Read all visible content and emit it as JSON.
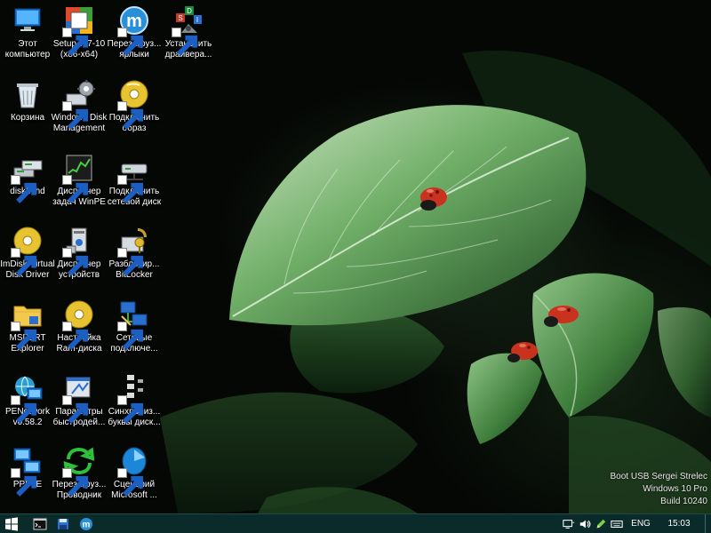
{
  "desktop": {
    "icons": [
      {
        "label": "Этот\nкомпьютер",
        "icon": "computer-icon",
        "shortcut": false
      },
      {
        "label": "Setup W7-10\n(x86-x64)",
        "icon": "setup-icon",
        "shortcut": true
      },
      {
        "label": "Перезагруз...\nярлыки",
        "icon": "m-circle-icon",
        "shortcut": true
      },
      {
        "label": "Установить\nдрайвера...",
        "icon": "sdi-icon",
        "shortcut": true
      },
      {
        "label": "Корзина",
        "icon": "recycle-bin-icon",
        "shortcut": false
      },
      {
        "label": "Windows Disk\nManagement",
        "icon": "disk-management-icon",
        "shortcut": true
      },
      {
        "label": "Подключить\nобраз",
        "icon": "disc-icon",
        "shortcut": true
      },
      {
        "label": "disk2vhd",
        "icon": "disk2vhd-icon",
        "shortcut": true
      },
      {
        "label": "Диспетчер\nзадач WinPE",
        "icon": "task-manager-icon",
        "shortcut": true
      },
      {
        "label": "Подключить\nсетевой диск",
        "icon": "network-drive-icon",
        "shortcut": true
      },
      {
        "label": "ImDisk Virtual\nDisk Driver",
        "icon": "imdisk-icon",
        "shortcut": true
      },
      {
        "label": "Диспетчер\nустройств",
        "icon": "device-manager-icon",
        "shortcut": true
      },
      {
        "label": "Разблокир...\nBitLocker",
        "icon": "bitlocker-icon",
        "shortcut": true
      },
      {
        "label": "MSDaRT\nExplorer",
        "icon": "folder-icon",
        "shortcut": true
      },
      {
        "label": "Настройка\nRam-диска",
        "icon": "ramdisk-icon",
        "shortcut": true
      },
      {
        "label": "Сетевые\nподключе...",
        "icon": "network-connections-icon",
        "shortcut": true
      },
      {
        "label": "PENetwork\nv0.58.2",
        "icon": "penetwork-icon",
        "shortcut": true
      },
      {
        "label": "Параметры\nбыстродей...",
        "icon": "performance-icon",
        "shortcut": true
      },
      {
        "label": "Синхрониз...\nбуквы диск...",
        "icon": "sync-letters-icon",
        "shortcut": true
      },
      {
        "label": "PPPoE",
        "icon": "pppoe-icon",
        "shortcut": true
      },
      {
        "label": "Перезагруз...\nПроводник",
        "icon": "refresh-icon",
        "shortcut": true
      },
      {
        "label": "Сценарий\nMicrosoft ...",
        "icon": "script-icon",
        "shortcut": true
      }
    ]
  },
  "watermark": {
    "line1": "Boot USB Sergei Strelec",
    "line2": "Windows 10 Pro",
    "line3": "Build 10240"
  },
  "taskbar": {
    "start_icon": "windows-start-icon",
    "pinned": [
      "cmd-icon",
      "save-disk-icon",
      "m-circle-icon"
    ],
    "tray": {
      "lang": "ENG",
      "time": "15:03"
    }
  },
  "colors": {
    "taskbar_bg": "#0b2a2a",
    "leaf_green": "#5f9a5a",
    "ladybug_red": "#c8321e"
  }
}
